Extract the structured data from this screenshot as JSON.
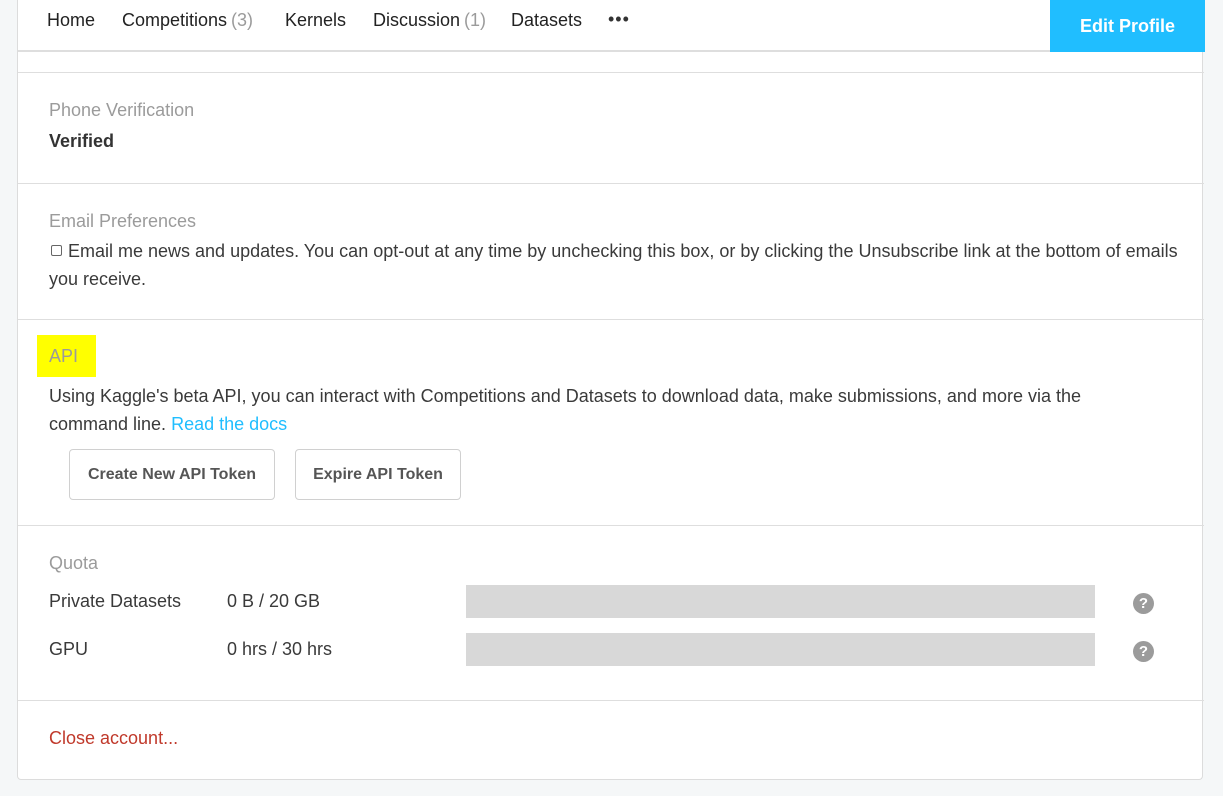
{
  "nav": {
    "home": "Home",
    "competitions": "Competitions",
    "competitions_count": "(3)",
    "kernels": "Kernels",
    "discussion": "Discussion",
    "discussion_count": "(1)",
    "datasets": "Datasets",
    "more": "•••",
    "edit_profile": "Edit Profile"
  },
  "phone": {
    "title": "Phone Verification",
    "status": "Verified"
  },
  "email": {
    "title": "Email Preferences",
    "checked": false,
    "text": "Email me news and updates. You can opt-out at any time by unchecking this box, or by clicking the Unsubscribe link at the bottom of emails you receive."
  },
  "api": {
    "title": "API",
    "highlight_color": "#ffff00",
    "description": "Using Kaggle's beta API, you can interact with Competitions and Datasets to download data, make submissions, and more via the command line.",
    "docs_link": "Read the docs",
    "create_button": "Create New API Token",
    "expire_button": "Expire API Token"
  },
  "quota": {
    "title": "Quota",
    "rows": [
      {
        "label": "Private Datasets",
        "value": "0 B / 20 GB",
        "used_fraction": 0
      },
      {
        "label": "GPU",
        "value": "0 hrs / 30 hrs",
        "used_fraction": 0
      }
    ],
    "help_icon": "question-circle-icon"
  },
  "close_account": "Close account...",
  "colors": {
    "accent": "#20beff",
    "danger": "#c0392b",
    "muted": "#9b9b9b"
  }
}
